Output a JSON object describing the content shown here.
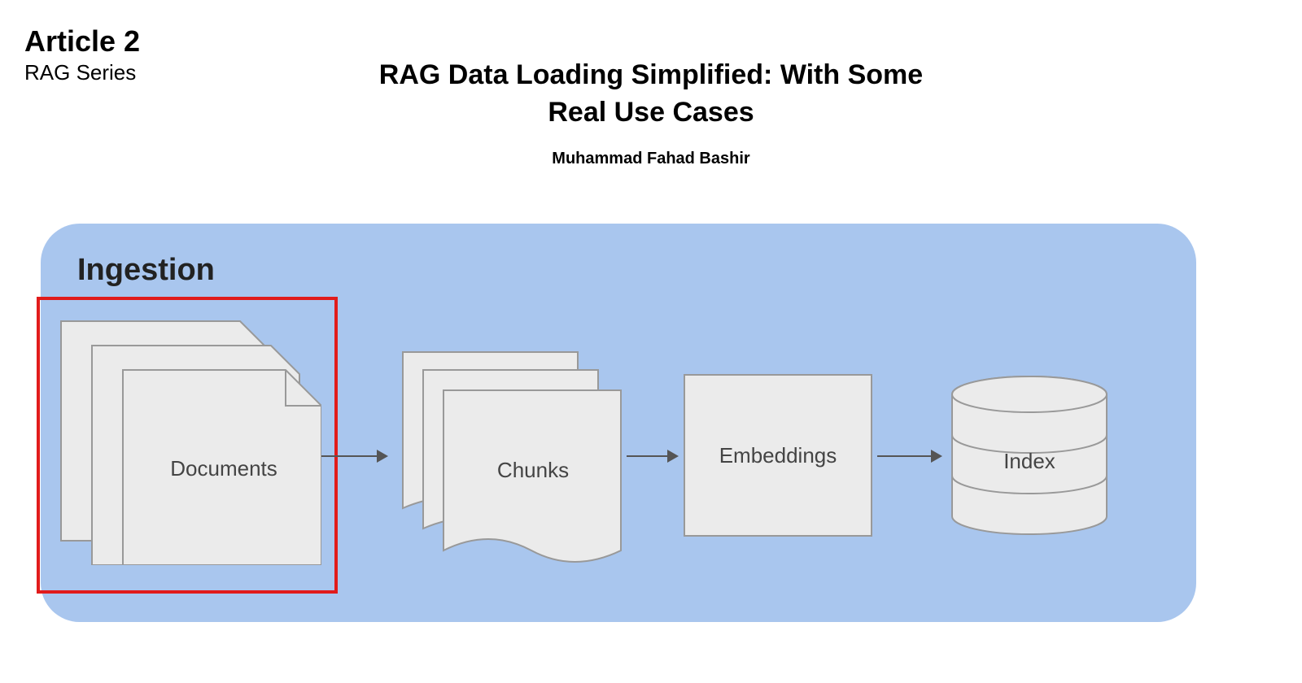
{
  "header": {
    "article_number": "Article 2",
    "series_name": "RAG Series"
  },
  "title": "RAG Data Loading Simplified: With Some Real Use Cases",
  "author": "Muhammad Fahad Bashir",
  "diagram": {
    "section_label": "Ingestion",
    "nodes": {
      "documents": "Documents",
      "chunks": "Chunks",
      "embeddings": "Embeddings",
      "index": "Index"
    },
    "highlighted_node": "documents"
  }
}
